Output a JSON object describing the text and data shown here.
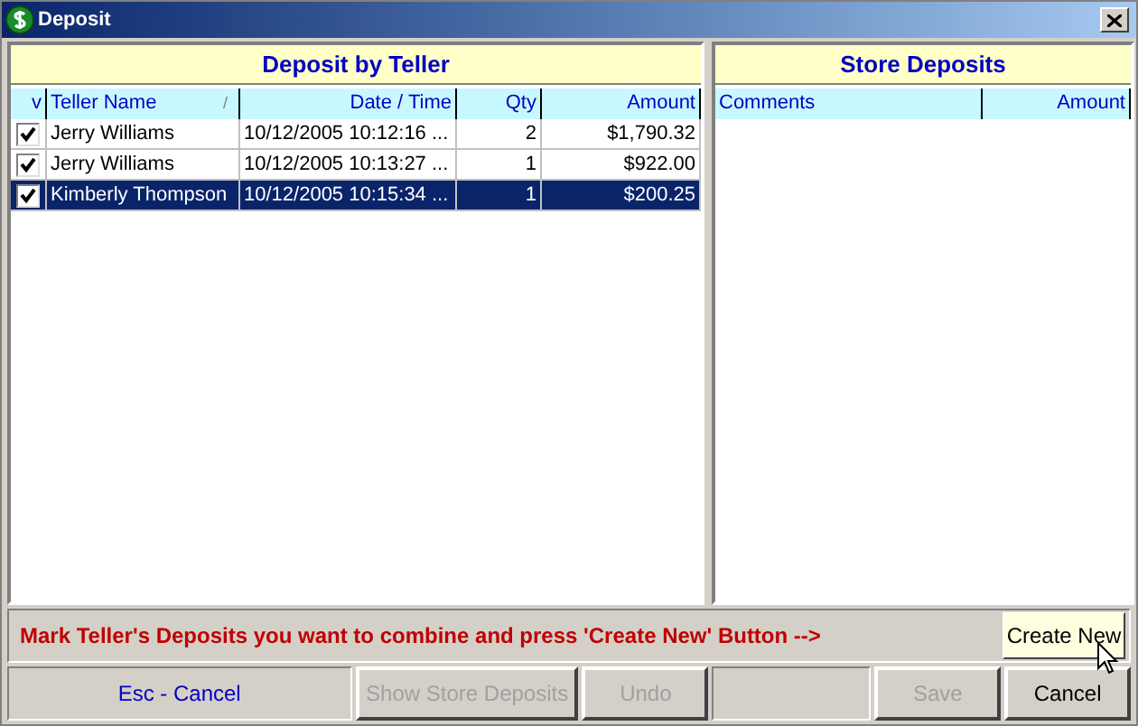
{
  "window": {
    "title": "Deposit"
  },
  "teller_panel": {
    "title": "Deposit by Teller",
    "check_column": {
      "label": "v"
    },
    "columns": [
      {
        "label": "Teller Name",
        "sort": "/"
      },
      {
        "label": "Date / Time"
      },
      {
        "label": "Qty"
      },
      {
        "label": "Amount"
      }
    ],
    "rows": [
      {
        "checked": true,
        "selected": false,
        "cells": [
          "Jerry Williams",
          "10/12/2005 10:12:16 ...",
          "2",
          "$1,790.32"
        ]
      },
      {
        "checked": true,
        "selected": false,
        "cells": [
          "Jerry Williams",
          "10/12/2005 10:13:27 ...",
          "1",
          "$922.00"
        ]
      },
      {
        "checked": true,
        "selected": true,
        "cells": [
          "Kimberly Thompson",
          "10/12/2005 10:15:34 ...",
          "1",
          "$200.25"
        ]
      }
    ]
  },
  "store_panel": {
    "title": "Store Deposits",
    "columns": [
      {
        "label": "Comments"
      },
      {
        "label": "Amount"
      }
    ]
  },
  "message": "Mark Teller's Deposits you want to combine and press 'Create New' Button -->",
  "create_button": {
    "label": "Create New",
    "disabled": false
  },
  "hint": "Esc - Cancel",
  "buttons": [
    {
      "kind": "button",
      "label": "Show Store Deposits",
      "disabled": true
    },
    {
      "kind": "button",
      "label": "Undo",
      "disabled": true
    },
    {
      "kind": "spacer"
    },
    {
      "kind": "button",
      "label": "Save",
      "disabled": true
    },
    {
      "kind": "button",
      "label": "Cancel",
      "disabled": false
    }
  ]
}
